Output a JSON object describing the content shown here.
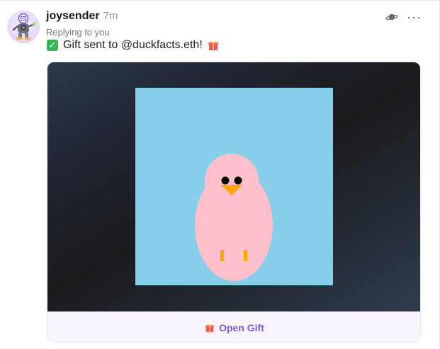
{
  "post": {
    "username": "joysender",
    "timestamp": "7m",
    "reply_note": "Replying to you",
    "message": "Gift sent to @duckfacts.eth!",
    "avatar": "robot-avatar",
    "check_icon": "check-mark-button-icon",
    "gift_icon": "wrapped-gift-icon"
  },
  "actions": {
    "channel_icon": "planet-icon",
    "more_icon": "more-horizontal-icon",
    "more_glyph": "···"
  },
  "gift_card": {
    "artwork": "duck-artwork",
    "button_label": "Open Gift",
    "colors": {
      "sky": "#87ceeb",
      "duck_body": "#ffc0cb",
      "beak": "#ffa500",
      "button_text": "#7c57d6",
      "button_bg": "#f8f5fe"
    }
  }
}
